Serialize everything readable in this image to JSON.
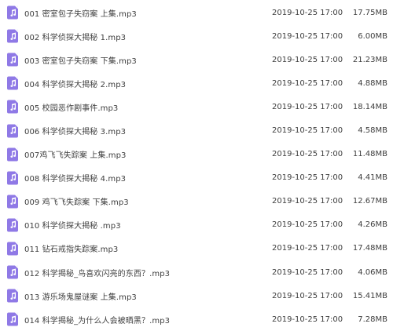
{
  "file_list": {
    "accent_color": "#8f79e6",
    "items": [
      {
        "icon": "music-file-icon",
        "name": "001 密室包子失窃案 上集.mp3",
        "modified": "2019-10-25 17:00",
        "size": "17.75MB"
      },
      {
        "icon": "music-file-icon",
        "name": "002 科学侦探大揭秘 1.mp3",
        "modified": "2019-10-25 17:00",
        "size": "6.00MB"
      },
      {
        "icon": "music-file-icon",
        "name": "003 密室包子失窃案 下集.mp3",
        "modified": "2019-10-25 17:00",
        "size": "21.23MB"
      },
      {
        "icon": "music-file-icon",
        "name": "004 科学侦探大揭秘 2.mp3",
        "modified": "2019-10-25 17:00",
        "size": "4.88MB"
      },
      {
        "icon": "music-file-icon",
        "name": "005 校园恶作剧事件.mp3",
        "modified": "2019-10-25 17:00",
        "size": "18.14MB"
      },
      {
        "icon": "music-file-icon",
        "name": "006 科学侦探大揭秘 3.mp3",
        "modified": "2019-10-25 17:00",
        "size": "4.58MB"
      },
      {
        "icon": "music-file-icon",
        "name": "007鸡飞飞失踪案 上集.mp3",
        "modified": "2019-10-25 17:00",
        "size": "11.48MB"
      },
      {
        "icon": "music-file-icon",
        "name": "008 科学侦探大揭秘 4.mp3",
        "modified": "2019-10-25 17:00",
        "size": "4.41MB"
      },
      {
        "icon": "music-file-icon",
        "name": "009 鸡飞飞失踪案 下集.mp3",
        "modified": "2019-10-25 17:00",
        "size": "12.67MB"
      },
      {
        "icon": "music-file-icon",
        "name": "010 科学侦探大揭秘 .mp3",
        "modified": "2019-10-25 17:00",
        "size": "4.26MB"
      },
      {
        "icon": "music-file-icon",
        "name": "011 钻石戒指失踪案.mp3",
        "modified": "2019-10-25 17:00",
        "size": "17.48MB"
      },
      {
        "icon": "music-file-icon",
        "name": "012 科学揭秘_鸟喜欢闪亮的东西？.mp3",
        "modified": "2019-10-25 17:00",
        "size": "4.06MB"
      },
      {
        "icon": "music-file-icon",
        "name": "013 游乐场鬼屋谜案 上集.mp3",
        "modified": "2019-10-25 17:00",
        "size": "15.41MB"
      },
      {
        "icon": "music-file-icon",
        "name": "014 科学揭秘_为什么人会被晒黑？.mp3",
        "modified": "2019-10-25 17:00",
        "size": "7.28MB"
      }
    ]
  }
}
